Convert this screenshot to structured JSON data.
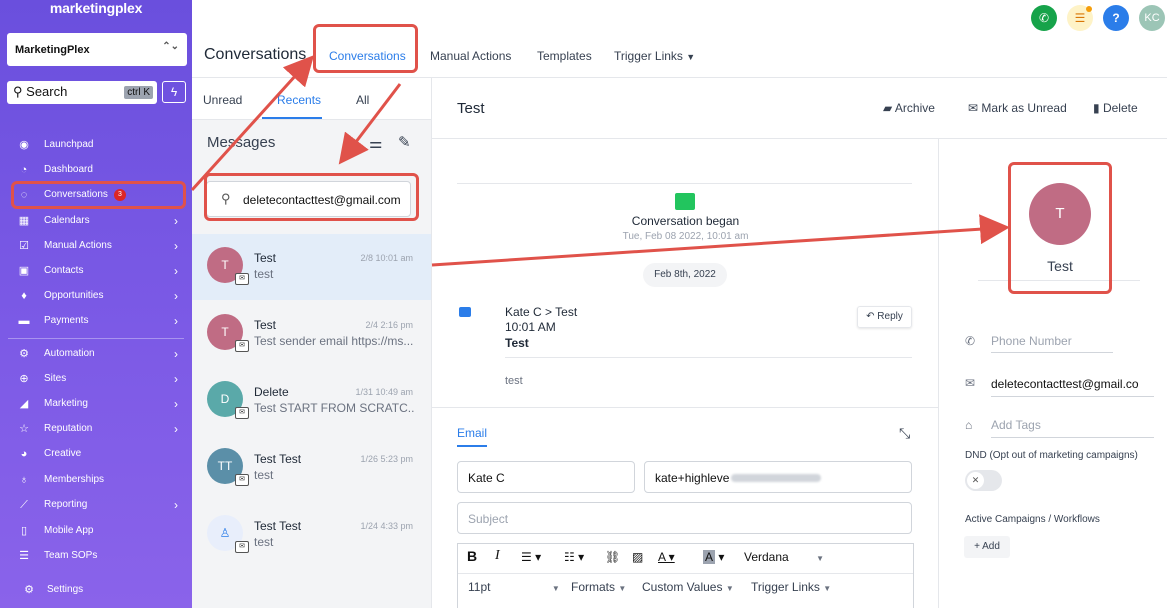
{
  "sidebar": {
    "brand": "marketingplex",
    "account": "MarketingPlex",
    "search_label": "Search",
    "search_shortcut": "ctrl K",
    "items": [
      {
        "label": "Launchpad",
        "icon": "launchpad-icon"
      },
      {
        "label": "Dashboard",
        "icon": "dashboard-icon"
      },
      {
        "label": "Conversations",
        "icon": "chat-icon",
        "badge": "3"
      },
      {
        "label": "Calendars",
        "icon": "calendar-icon"
      },
      {
        "label": "Manual Actions",
        "icon": "checklist-icon"
      },
      {
        "label": "Contacts",
        "icon": "contacts-icon"
      },
      {
        "label": "Opportunities",
        "icon": "opportunities-icon"
      },
      {
        "label": "Payments",
        "icon": "payments-icon"
      },
      {
        "label": "Automation",
        "icon": "automation-icon"
      },
      {
        "label": "Sites",
        "icon": "globe-icon"
      },
      {
        "label": "Marketing",
        "icon": "megaphone-icon"
      },
      {
        "label": "Reputation",
        "icon": "star-icon"
      },
      {
        "label": "Creative",
        "icon": "palette-icon"
      },
      {
        "label": "Memberships",
        "icon": "badge-icon"
      },
      {
        "label": "Reporting",
        "icon": "chart-icon"
      },
      {
        "label": "Mobile App",
        "icon": "mobile-icon"
      },
      {
        "label": "Team SOPs",
        "icon": "list-icon"
      }
    ],
    "settings": "Settings"
  },
  "header": {
    "title": "Conversations",
    "tabs": [
      "Conversations",
      "Manual Actions",
      "Templates",
      "Trigger Links"
    ],
    "user_initials": "KC"
  },
  "list": {
    "tabs": [
      "Unread",
      "Recents",
      "All"
    ],
    "heading": "Messages",
    "search_value": "deletecontacttest@gmail.com",
    "conversations": [
      {
        "initial": "T",
        "name": "Test",
        "date": "2/8 10:01 am",
        "preview": "test",
        "color": "#c06c84"
      },
      {
        "initial": "T",
        "name": "Test",
        "date": "2/4 2:16 pm",
        "preview": "Test sender email https://ms...",
        "color": "#c06c84"
      },
      {
        "initial": "D",
        "name": "Delete",
        "date": "1/31 10:49 am",
        "preview": "Test START FROM SCRATC...",
        "color": "#5aa9a9"
      },
      {
        "initial": "TT",
        "name": "Test Test",
        "date": "1/26 5:23 pm",
        "preview": "test",
        "color": "#5b8fa8"
      },
      {
        "initial": "",
        "name": "Test Test",
        "date": "1/24 4:33 pm",
        "preview": "test",
        "color": "#e8eefb"
      }
    ]
  },
  "thread": {
    "title": "Test",
    "actions": [
      "Archive",
      "Mark as Unread",
      "Delete"
    ],
    "began_label": "Conversation began",
    "began_time": "Tue, Feb 08 2022, 10:01 am",
    "date_pill": "Feb 8th, 2022",
    "message": {
      "route": "Kate C > Test",
      "time": "10:01 AM",
      "subject": "Test",
      "body": "test",
      "reply": "Reply"
    },
    "composer": {
      "tab": "Email",
      "from_name": "Kate C",
      "from_email": "kate+highleve",
      "subject_placeholder": "Subject",
      "font": "Verdana",
      "size": "11pt",
      "formats": "Formats",
      "custom_values": "Custom Values",
      "trigger_links": "Trigger Links"
    }
  },
  "contact": {
    "initial": "T",
    "name": "Test",
    "phone_placeholder": "Phone Number",
    "email": "deletecontacttest@gmail.co",
    "tags_placeholder": "Add Tags",
    "dnd_label": "DND (Opt out of marketing campaigns)",
    "campaigns_label": "Active Campaigns / Workflows",
    "add_label": "+ Add"
  },
  "colors": {
    "accent": "#2b7de9",
    "sidebar": "#6a4fdd",
    "annotation": "#e0524a"
  }
}
